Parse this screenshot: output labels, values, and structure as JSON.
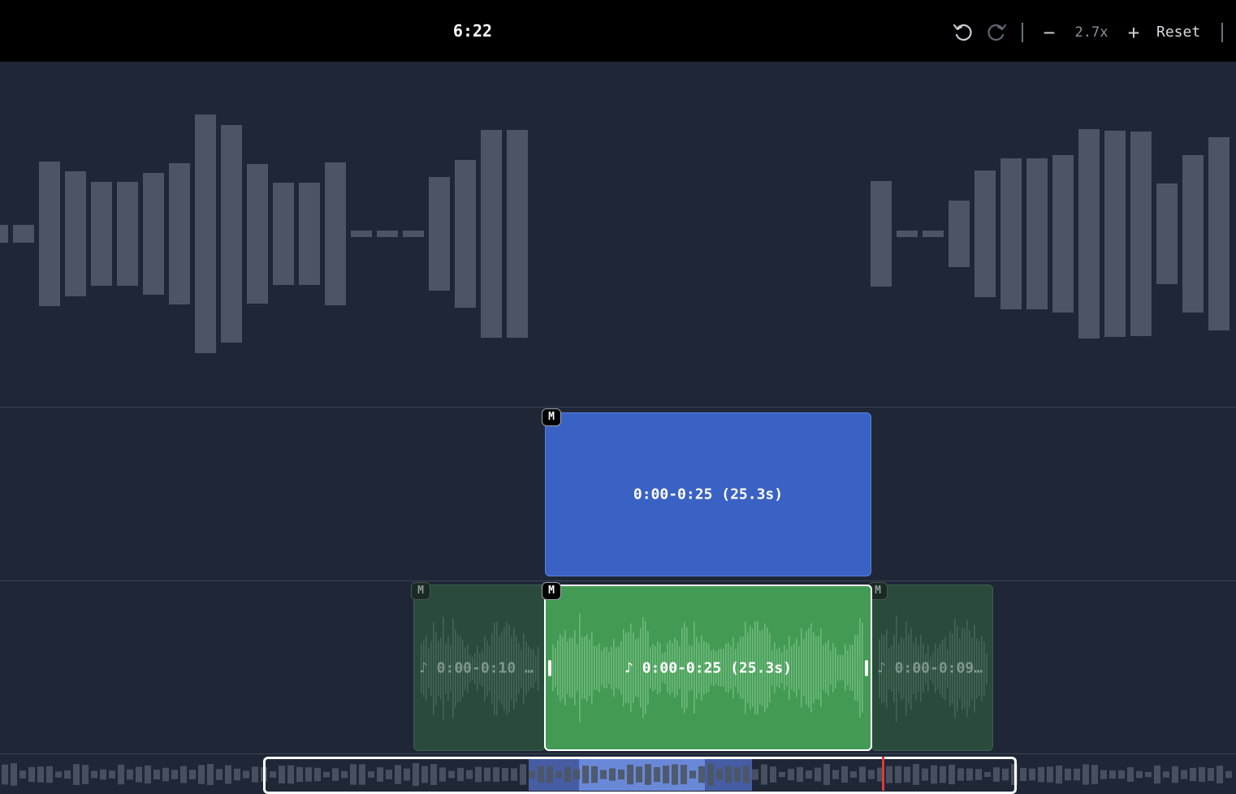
{
  "header": {
    "time": "6:22",
    "undo_icon": "undo-icon",
    "redo_icon": "redo-icon",
    "zoom_out_label": "−",
    "zoom_level": "2.7x",
    "zoom_in_label": "+",
    "reset_label": "Reset"
  },
  "tracks": {
    "video_clip": {
      "label": "0:00-0:25 (25.3s)",
      "badge": "M",
      "color": "#3a62c4"
    },
    "audio_clips": [
      {
        "label": "♪ 0:00-0:10 …",
        "badge": "M",
        "state": "dim"
      },
      {
        "label": "♪ 0:00-0:25 (25.3s)",
        "badge": "M",
        "state": "selected"
      },
      {
        "label": "♪ 0:00-0:09…",
        "badge": "M",
        "state": "dim"
      }
    ]
  },
  "colors": {
    "background": "#1f2736",
    "waveform_bar": "#4b5563",
    "video_clip": "#3a62c4",
    "audio_clip": "#439a54",
    "playhead": "#e53935"
  }
}
